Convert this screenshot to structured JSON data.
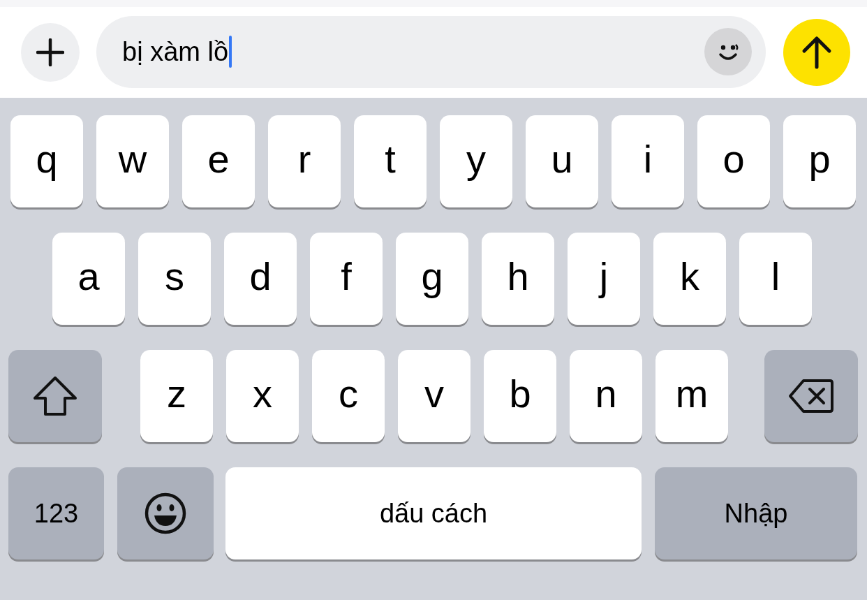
{
  "input_bar": {
    "value": "bị xàm lồ"
  },
  "keyboard": {
    "rows": [
      {
        "keys": [
          {
            "kind": "letter",
            "label": "q"
          },
          {
            "kind": "letter",
            "label": "w"
          },
          {
            "kind": "letter",
            "label": "e"
          },
          {
            "kind": "letter",
            "label": "r"
          },
          {
            "kind": "letter",
            "label": "t"
          },
          {
            "kind": "letter",
            "label": "y"
          },
          {
            "kind": "letter",
            "label": "u"
          },
          {
            "kind": "letter",
            "label": "i"
          },
          {
            "kind": "letter",
            "label": "o"
          },
          {
            "kind": "letter",
            "label": "p"
          }
        ]
      },
      {
        "keys": [
          {
            "kind": "letter",
            "label": "a"
          },
          {
            "kind": "letter",
            "label": "s"
          },
          {
            "kind": "letter",
            "label": "d"
          },
          {
            "kind": "letter",
            "label": "f"
          },
          {
            "kind": "letter",
            "label": "g"
          },
          {
            "kind": "letter",
            "label": "h"
          },
          {
            "kind": "letter",
            "label": "j"
          },
          {
            "kind": "letter",
            "label": "k"
          },
          {
            "kind": "letter",
            "label": "l"
          }
        ]
      },
      {
        "keys": [
          {
            "kind": "shift"
          },
          {
            "kind": "letter",
            "label": "z"
          },
          {
            "kind": "letter",
            "label": "x"
          },
          {
            "kind": "letter",
            "label": "c"
          },
          {
            "kind": "letter",
            "label": "v"
          },
          {
            "kind": "letter",
            "label": "b"
          },
          {
            "kind": "letter",
            "label": "n"
          },
          {
            "kind": "letter",
            "label": "m"
          },
          {
            "kind": "delete"
          }
        ]
      }
    ],
    "bottom_row": {
      "numbers_key": "123",
      "space_key": "dấu cách",
      "return_key": "Nhập"
    }
  }
}
